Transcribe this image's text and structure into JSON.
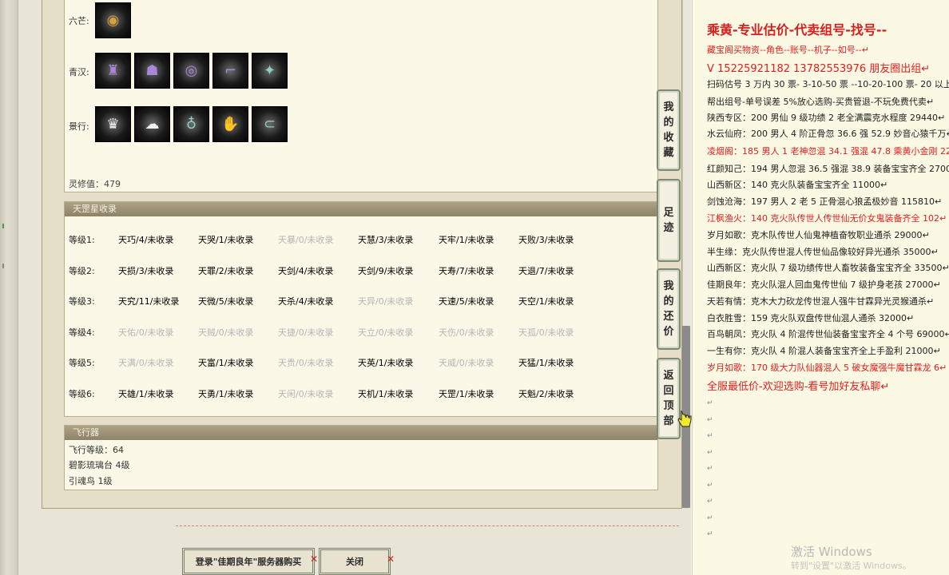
{
  "equipment": {
    "rows": [
      {
        "label": "六芒:",
        "icons": [
          "ring-icon"
        ]
      },
      {
        "label": "青汉:",
        "icons": [
          "armor-icon",
          "mask-icon",
          "bracelet-icon",
          "boots-icon",
          "staff-icon"
        ]
      },
      {
        "label": "景行:",
        "icons": [
          "robe-icon",
          "helmet-icon",
          "amulet-icon",
          "gloves-icon",
          "belt-icon"
        ]
      }
    ],
    "lingxiu": "灵修值：479"
  },
  "star_collection": {
    "header": "天罡星收录",
    "levels": [
      {
        "label": "等级1:",
        "cells": [
          {
            "text": "天巧/4/未收录",
            "dim": false
          },
          {
            "text": "天哭/1/未收录",
            "dim": false
          },
          {
            "text": "天暴/0/未收录",
            "dim": true
          },
          {
            "text": "天慧/3/未收录",
            "dim": false
          },
          {
            "text": "天牢/1/未收录",
            "dim": false
          },
          {
            "text": "天败/3/未收录",
            "dim": false
          }
        ]
      },
      {
        "label": "等级2:",
        "cells": [
          {
            "text": "天损/3/未收录",
            "dim": false
          },
          {
            "text": "天罪/2/未收录",
            "dim": false
          },
          {
            "text": "天剑/4/未收录",
            "dim": false
          },
          {
            "text": "天剑/9/未收录",
            "dim": false
          },
          {
            "text": "天寿/7/未收录",
            "dim": false
          },
          {
            "text": "天退/7/未收录",
            "dim": false
          }
        ]
      },
      {
        "label": "等级3:",
        "cells": [
          {
            "text": "天究/11/未收录",
            "dim": false
          },
          {
            "text": "天微/5/未收录",
            "dim": false
          },
          {
            "text": "天杀/4/未收录",
            "dim": false
          },
          {
            "text": "天异/0/未收录",
            "dim": true
          },
          {
            "text": "天速/5/未收录",
            "dim": false
          },
          {
            "text": "天空/1/未收录",
            "dim": false
          }
        ]
      },
      {
        "label": "等级4:",
        "cells": [
          {
            "text": "天佑/0/未收录",
            "dim": true
          },
          {
            "text": "天贼/0/未收录",
            "dim": true
          },
          {
            "text": "天捷/0/未收录",
            "dim": true
          },
          {
            "text": "天立/0/未收录",
            "dim": true
          },
          {
            "text": "天伤/0/未收录",
            "dim": true
          },
          {
            "text": "天孤/0/未收录",
            "dim": true
          }
        ]
      },
      {
        "label": "等级5:",
        "cells": [
          {
            "text": "天满/0/未收录",
            "dim": true
          },
          {
            "text": "天富/1/未收录",
            "dim": false
          },
          {
            "text": "天贵/0/未收录",
            "dim": true
          },
          {
            "text": "天英/1/未收录",
            "dim": false
          },
          {
            "text": "天威/0/未收录",
            "dim": true
          },
          {
            "text": "天猛/1/未收录",
            "dim": false
          }
        ]
      },
      {
        "label": "等级6:",
        "cells": [
          {
            "text": "天雄/1/未收录",
            "dim": false
          },
          {
            "text": "天勇/1/未收录",
            "dim": false
          },
          {
            "text": "天闲/0/未收录",
            "dim": true
          },
          {
            "text": "天机/1/未收录",
            "dim": false
          },
          {
            "text": "天罡/1/未收录",
            "dim": false
          },
          {
            "text": "天魁/2/未收录",
            "dim": false
          }
        ]
      }
    ]
  },
  "flyer": {
    "header": "飞行器",
    "level": "飞行等级：64",
    "item1": "碧影琉璃台   4级",
    "item2": "引魂鸟   1级"
  },
  "side_buttons": {
    "favorites": "我的收藏",
    "footprint": "足迹",
    "bargain": "我的还价",
    "top": "返回顶部"
  },
  "bottom": {
    "login_button": "登录\"佳期良年\"服务器购买",
    "close_button": "关闭"
  },
  "right_panel": {
    "title": "乘黄-专业估价-代卖组号-找号--",
    "lines": [
      {
        "text": "藏宝阁买物资--角色--账号--机子--如号--",
        "red": true,
        "big": false
      },
      {
        "text": "V 15225921182        13782553976 朋友圈出组",
        "red": true,
        "big": true
      },
      {
        "text": "扫码估号 3 万内 30 票-  3-10-50 票  --10-20-100 票-  20 以上",
        "red": false,
        "big": false
      },
      {
        "text": "帮出组号-单号误差 5%放心选购-买贵管退-不玩免费代卖",
        "red": false,
        "big": false
      },
      {
        "text": "陕西专区：200 男仙 9 级功绩 2 老全满震克水程度 29440",
        "red": false,
        "big": false
      },
      {
        "text": "水云仙府：200 男人 4 阶正骨忽 36.6 强 52.9 妙音心猿千万",
        "red": false,
        "big": false
      },
      {
        "text": "凌烟阁：185 男人 1 老神忽混 34.1 强混 47.8 乘黄小金刚 22",
        "red": true,
        "big": false
      },
      {
        "text": "红颜知己：194 男人忽混 36.5 强混 38.9 装备宝宝齐全 2700",
        "red": false,
        "big": false
      },
      {
        "text": "山西新区：140 克火队装备宝宝齐全 11000",
        "red": false,
        "big": false
      },
      {
        "text": "剑蚀沧海：197 男人 2 老 5 正骨混心狼孟极妙音 115810",
        "red": false,
        "big": false
      },
      {
        "text": "江枫渔火：140 克火队传世人传世仙无价女鬼装备齐全 102",
        "red": true,
        "big": false
      },
      {
        "text": "岁月如歌：克木队传世人仙鬼神植奋牧职业通杀 29000",
        "red": false,
        "big": false
      },
      {
        "text": "半生缘：克火队传世混人传世仙品像较好异光通杀 35000",
        "red": false,
        "big": false
      },
      {
        "text": "山西新区：克火队 7 级功绩传世人畜牧装备宝宝齐全 33500",
        "red": false,
        "big": false
      },
      {
        "text": "佳期良年：克火队混人回血鬼传世仙 7 级护身老孩 27000",
        "red": false,
        "big": false
      },
      {
        "text": "天若有情：克木大力砍龙传世混人强牛甘霖异光灵猴通杀",
        "red": false,
        "big": false
      },
      {
        "text": "白衣胜雪：159 克火队双盘传世仙混人通杀 32000",
        "red": false,
        "big": false
      },
      {
        "text": "百鸟朝凤：克火队 4 阶混传世仙装备宝宝齐全 4 个号 69000",
        "red": false,
        "big": false
      },
      {
        "text": "一生有你：克火队 4 阶混人装备宝宝齐全上手盈利 21000",
        "red": false,
        "big": false
      },
      {
        "text": "岁月如歌：170 级大力队仙器混人 5 破女魔强牛魔甘霖龙 6",
        "red": true,
        "big": false
      },
      {
        "text": "全服最低价-欢迎选购-看号加好友私聊",
        "red": true,
        "big": true
      }
    ],
    "return_mark": "↵"
  },
  "watermark": {
    "line1": "激活 Windows",
    "line2": "转到\"设置\"以激活 Windows。"
  }
}
